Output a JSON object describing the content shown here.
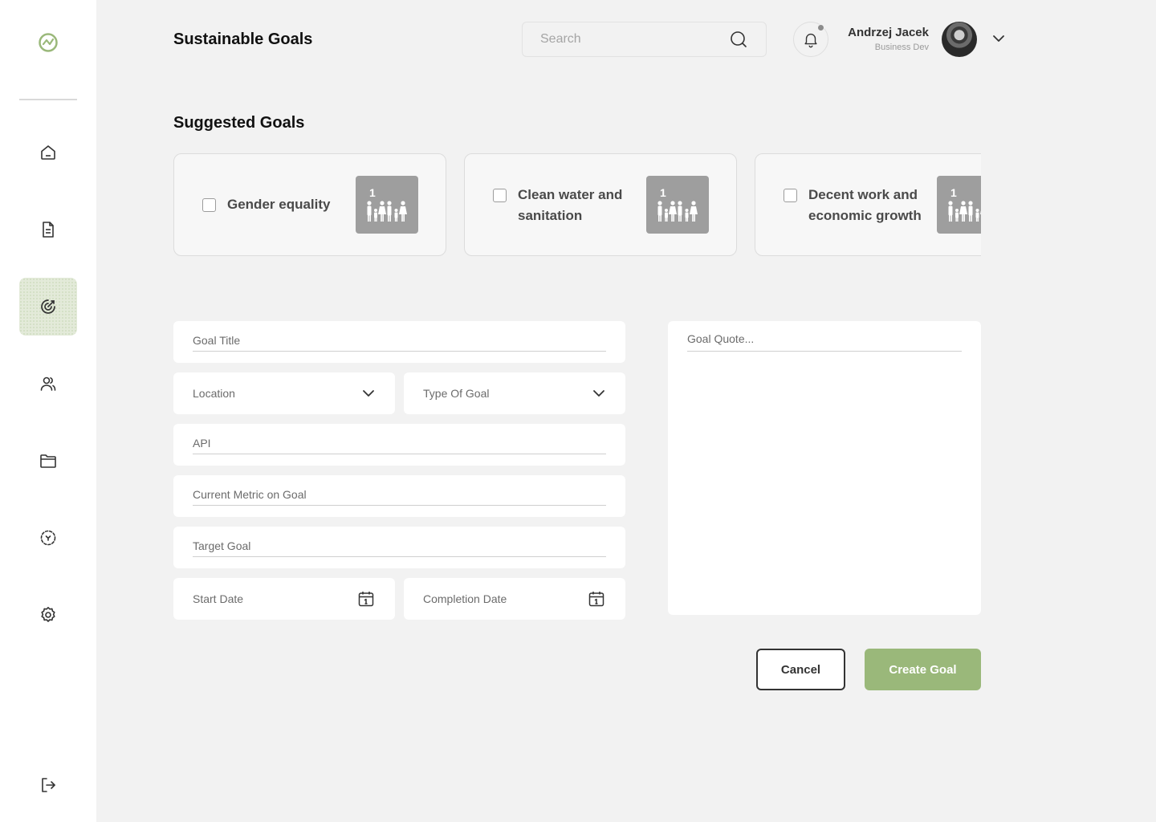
{
  "header": {
    "title": "Sustainable Goals",
    "search_placeholder": "Search",
    "user": {
      "name": "Andrzej Jacek",
      "role": "Business Dev"
    }
  },
  "sidebar": {
    "items": [
      {
        "icon": "home-icon"
      },
      {
        "icon": "document-icon"
      },
      {
        "icon": "target-icon",
        "active": true
      },
      {
        "icon": "users-icon"
      },
      {
        "icon": "folder-icon"
      },
      {
        "icon": "scan-icon"
      },
      {
        "icon": "gear-icon"
      }
    ],
    "logout_icon": "logout-icon"
  },
  "suggested": {
    "title": "Suggested Goals",
    "cards": [
      {
        "label": "Gender equality",
        "badge_number": "1",
        "checked": false
      },
      {
        "label": "Clean water and sanitation",
        "badge_number": "1",
        "checked": false
      },
      {
        "label": "Decent work and economic growth",
        "badge_number": "1",
        "checked": false
      }
    ]
  },
  "form": {
    "goal_title_placeholder": "Goal Title",
    "location_label": "Location",
    "type_label": "Type Of Goal",
    "api_placeholder": "API",
    "current_metric_placeholder": "Current Metric on Goal",
    "target_goal_placeholder": "Target Goal",
    "start_date_label": "Start Date",
    "completion_date_label": "Completion Date",
    "quote_placeholder": "Goal Quote..."
  },
  "actions": {
    "cancel": "Cancel",
    "create": "Create Goal"
  },
  "colors": {
    "accent": "#9ab87a",
    "active_nav": "#e3ead9",
    "background": "#f2f2f2"
  }
}
